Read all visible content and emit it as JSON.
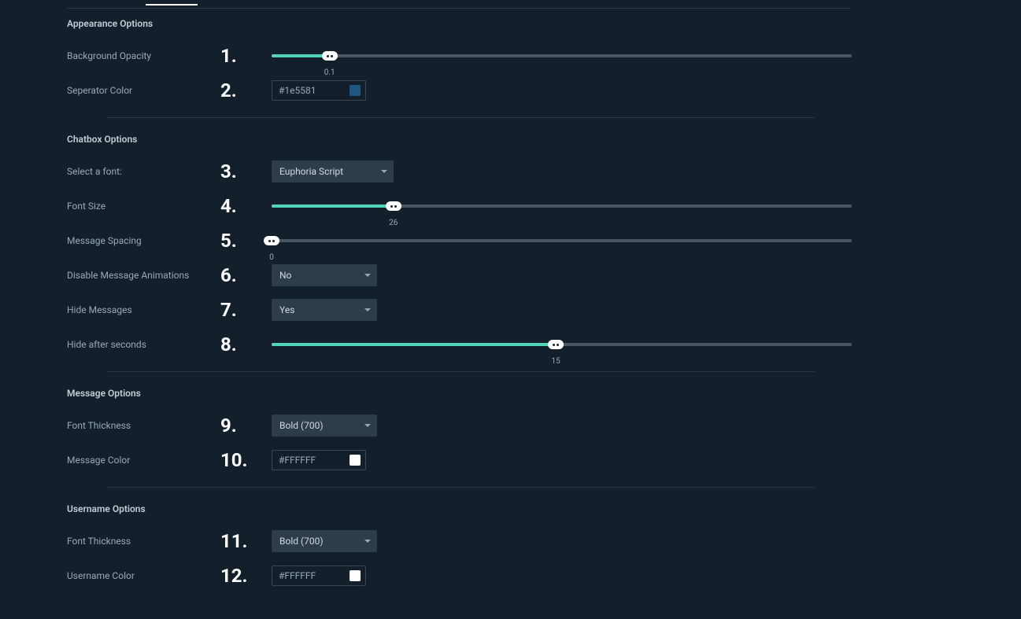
{
  "sections": {
    "appearance": {
      "title": "Appearance Options",
      "background_opacity": {
        "label": "Background Opacity",
        "value": "0.1",
        "percent": 10
      },
      "separator_color": {
        "label": "Seperator Color",
        "hex": "#1e5581",
        "swatch": "#1e5581"
      }
    },
    "chatbox": {
      "title": "Chatbox Options",
      "select_font": {
        "label": "Select a font:",
        "value": "Euphoria Script"
      },
      "font_size": {
        "label": "Font Size",
        "value": "26",
        "percent": 21
      },
      "message_spacing": {
        "label": "Message Spacing",
        "value": "0",
        "percent": 0
      },
      "disable_anim": {
        "label": "Disable Message Animations",
        "value": "No"
      },
      "hide_messages": {
        "label": "Hide Messages",
        "value": "Yes"
      },
      "hide_after": {
        "label": "Hide after seconds",
        "value": "15",
        "percent": 49
      }
    },
    "message": {
      "title": "Message Options",
      "font_thickness": {
        "label": "Font Thickness",
        "value": "Bold (700)"
      },
      "message_color": {
        "label": "Message Color",
        "hex": "#FFFFFF",
        "swatch": "#FFFFFF"
      }
    },
    "username": {
      "title": "Username Options",
      "font_thickness": {
        "label": "Font Thickness",
        "value": "Bold (700)"
      },
      "username_color": {
        "label": "Username Color",
        "hex": "#FFFFFF",
        "swatch": "#FFFFFF"
      }
    }
  },
  "markers": [
    "1.",
    "2.",
    "3.",
    "4.",
    "5.",
    "6.",
    "7.",
    "8.",
    "9.",
    "10.",
    "11.",
    "12."
  ],
  "colors": {
    "accent": "#4fd6b8"
  }
}
